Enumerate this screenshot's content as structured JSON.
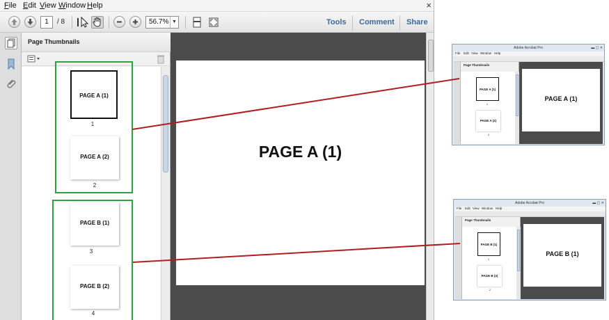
{
  "menu": {
    "items": [
      "File",
      "Edit",
      "View",
      "Window",
      "Help"
    ],
    "close": "×"
  },
  "toolbar": {
    "page_current": "1",
    "page_total": "/ 8",
    "zoom": "56.7%",
    "zoom_dropdown": "▼",
    "tools": "Tools",
    "comment": "Comment",
    "share": "Share"
  },
  "panel": {
    "title": "Page Thumbnails"
  },
  "thumbnails": [
    {
      "label": "PAGE A (1)",
      "num": "1",
      "selected": true
    },
    {
      "label": "PAGE A (2)",
      "num": "2",
      "selected": false
    },
    {
      "label": "PAGE B (1)",
      "num": "3",
      "selected": false
    },
    {
      "label": "PAGE B (2)",
      "num": "4",
      "selected": false
    }
  ],
  "document": {
    "page_title": "PAGE A (1)"
  },
  "mini_windows": [
    {
      "title": "Adobe Acrobat Pro",
      "menu": [
        "File",
        "Edit",
        "View",
        "Window",
        "Help"
      ],
      "panel_title": "Page Thumbnails",
      "thumbs": [
        {
          "label": "PAGE A (1)",
          "num": "1"
        },
        {
          "label": "PAGE A (2)",
          "num": "2"
        }
      ],
      "page_title": "PAGE A (1)"
    },
    {
      "title": "Adobe Acrobat Pro",
      "menu": [
        "File",
        "Edit",
        "View",
        "Window",
        "Help"
      ],
      "panel_title": "Page Thumbnails",
      "thumbs": [
        {
          "label": "PAGE B (1)",
          "num": "1"
        },
        {
          "label": "PAGE B (2)",
          "num": "2"
        }
      ],
      "page_title": "PAGE B (1)"
    }
  ],
  "colors": {
    "group_border": "#2f9e44",
    "connector": "#b01e23",
    "link_text": "#3b6a9a",
    "doc_bg": "#4b4b4b"
  }
}
